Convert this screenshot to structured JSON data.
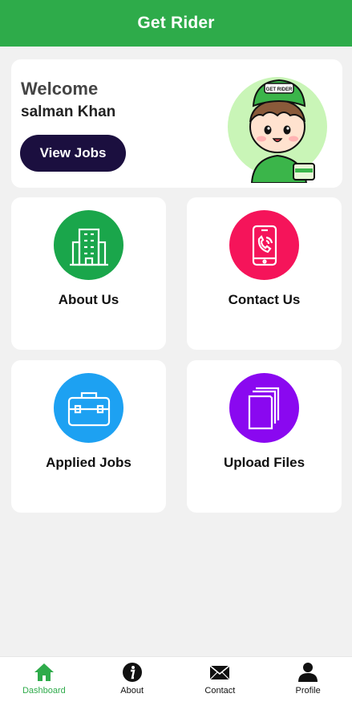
{
  "app_bar": {
    "title": "Get Rider"
  },
  "welcome_card": {
    "greeting": "Welcome",
    "user_name": "salman Khan",
    "button_label": "View Jobs",
    "mascot_cap_text": "GET RIDER"
  },
  "tiles": [
    {
      "label": "About Us",
      "icon": "building-icon",
      "color": "#1aa64b"
    },
    {
      "label": "Contact Us",
      "icon": "phone-icon",
      "color": "#f5145a"
    },
    {
      "label": "Applied Jobs",
      "icon": "briefcase-icon",
      "color": "#1da1f2"
    },
    {
      "label": "Upload Files",
      "icon": "files-icon",
      "color": "#8a08f0"
    }
  ],
  "bottom_nav": {
    "items": [
      {
        "label": "Dashboard",
        "icon": "home-icon",
        "active": true
      },
      {
        "label": "About",
        "icon": "info-icon",
        "active": false
      },
      {
        "label": "Contact",
        "icon": "mail-icon",
        "active": false
      },
      {
        "label": "Profile",
        "icon": "person-icon",
        "active": false
      }
    ]
  },
  "colors": {
    "primary": "#2eab4a",
    "button": "#1b0f3f",
    "background": "#f1f1f1"
  }
}
